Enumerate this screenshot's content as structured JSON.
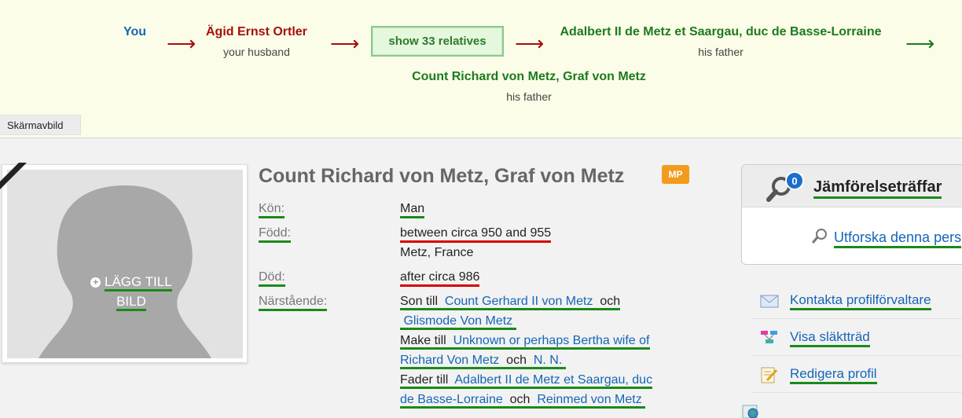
{
  "banner": {
    "you_label": "You",
    "husband_name": "Ägid Ernst Ortler",
    "husband_role": "your husband",
    "show_relatives_label": "show 33 relatives",
    "adalbert_name": "Adalbert II de Metz et Saargau, duc de Basse-Lorraine",
    "adalbert_role": "his father",
    "richard_name": "Count Richard von Metz, Graf von Metz",
    "richard_role": "his father",
    "arrow_glyph": "⟶",
    "tooltip": "Skärmavbild"
  },
  "photo": {
    "add_photo_line1": "LÄGG TILL",
    "add_photo_line2": "BILD"
  },
  "profile": {
    "name": "Count Richard von Metz, Graf von Metz",
    "badge": "MP",
    "gender_label": "Kön:",
    "gender_value": "Man",
    "born_label": "Född:",
    "born_date": "between circa 950 and 955",
    "born_place": "Metz, France",
    "died_label": "Död:",
    "died_date": "after circa 986",
    "family_label": "Närstående:",
    "son_of": "Son till",
    "father_link": "Count Gerhard II von Metz",
    "and1": "och",
    "mother_link": "Glismode Von Metz",
    "husband_of": "Make till",
    "wife_link_1": "Unknown or perhaps Bertha wife of",
    "wife_link_2": "Richard Von Metz",
    "and2": "och",
    "wife2_link": "N. N.",
    "father_of": "Fader till",
    "child_link_1": "Adalbert II de Metz et Saargau, duc",
    "child_link_2": "de Basse-Lorraine",
    "and3": "och",
    "child2_link": "Reinmed von Metz"
  },
  "sidebar": {
    "match_count": "0",
    "match_title": "Jämförelseträffar",
    "explore_link": "Utforska denna pers",
    "contact_manager": "Kontakta profilförvaltare",
    "view_tree": "Visa släktträd",
    "edit_profile": "Redigera profil"
  },
  "colors": {
    "you": "#1565b7",
    "husband": "#a50e0e",
    "green_name": "#1d7a1d",
    "link": "#1565b7",
    "green_underline": "#1a8a1a",
    "red_underline": "#d40000",
    "badge_orange": "#f29b1d"
  }
}
